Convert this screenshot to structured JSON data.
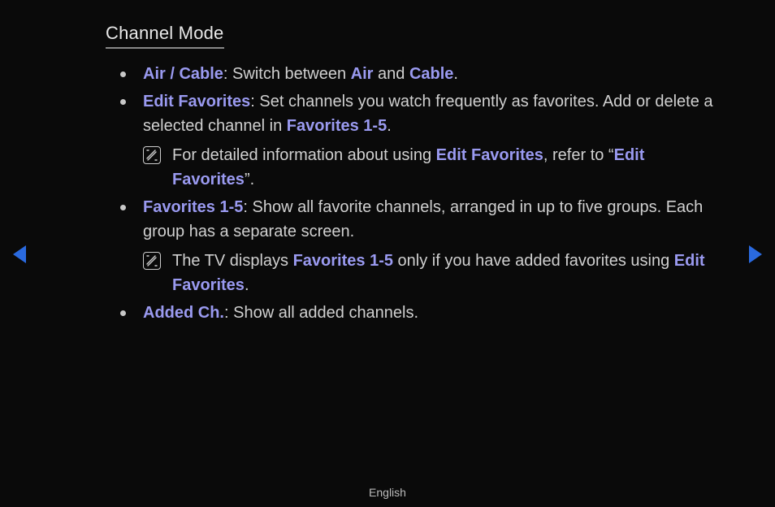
{
  "title": "Channel Mode",
  "items": [
    {
      "label": "Air / Cable",
      "desc_a": ": Switch between ",
      "hl_a": "Air",
      "mid": " and ",
      "hl_b": "Cable",
      "tail": "."
    },
    {
      "label": "Edit Favorites",
      "desc_a": ": Set channels you watch frequently as favorites. Add or delete a selected channel in ",
      "hl_a": "Favorites 1-5",
      "tail": ".",
      "note": {
        "pre": "For detailed information about using ",
        "hl_a": "Edit Favorites",
        "mid": ", refer to “",
        "hl_b": "Edit Favorites",
        "post": "”."
      }
    },
    {
      "label": "Favorites 1-5",
      "desc_a": ": Show all favorite channels, arranged in up to five groups. Each group has a separate screen.",
      "note": {
        "pre": "The TV displays ",
        "hl_a": "Favorites 1-5",
        "mid": " only if you have added favorites using ",
        "hl_b": "Edit Favorites",
        "post": "."
      }
    },
    {
      "label": "Added Ch.",
      "desc_a": ": Show all added channels."
    }
  ],
  "footer": "English"
}
